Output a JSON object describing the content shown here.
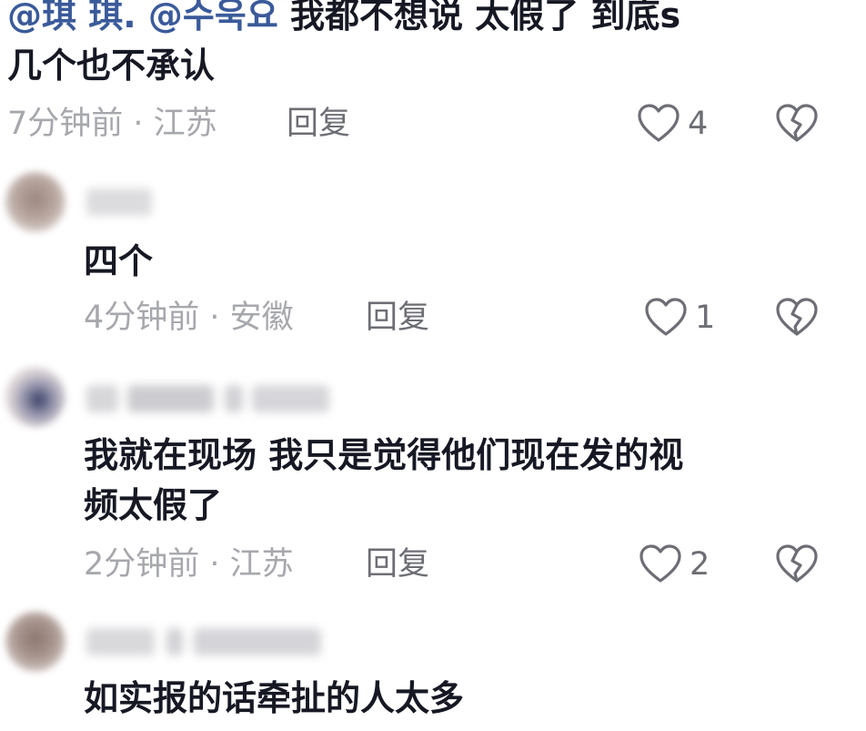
{
  "comments": [
    {
      "mentions": [
        "@琪 琪.",
        "@수욱요"
      ],
      "text_line1": "我都不想说 太假了 到底s",
      "text_line2": "几个也不承认",
      "time": "7分钟前 · 江苏",
      "reply_label": "回复",
      "likes": "4"
    },
    {
      "text": "四个",
      "time": "4分钟前 · 安徽",
      "reply_label": "回复",
      "likes": "1"
    },
    {
      "text_line1": "我就在现场 我只是觉得他们现在发的视",
      "text_line2": "频太假了",
      "time": "2分钟前 · 江苏",
      "reply_label": "回复",
      "likes": "2"
    },
    {
      "text": "如实报的话牵扯的人太多"
    }
  ],
  "icons": {
    "like": "heart-outline-icon",
    "dislike": "broken-heart-icon"
  },
  "colors": {
    "mention": "#3a5a9a",
    "text": "#161823",
    "meta": "#a7a8ad",
    "action": "#6d6e75"
  }
}
